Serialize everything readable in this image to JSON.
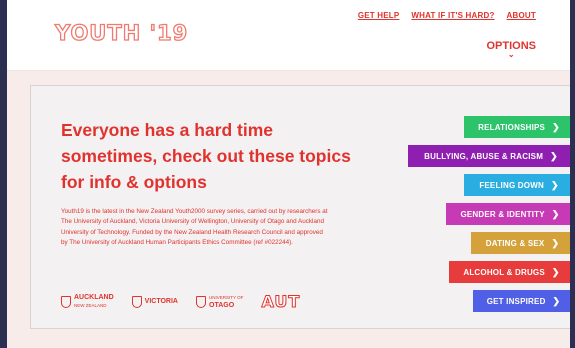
{
  "header": {
    "logo": "YOUTH '19",
    "links": [
      "GET HELP",
      "WHAT IF IT'S HARD?",
      "ABOUT"
    ],
    "options_label": "OPTIONS",
    "options_chevron": "⌄"
  },
  "main": {
    "headline": "Everyone has a hard time sometimes, check out these topics for info & options",
    "description": "Youth19 is the latest in the New Zealand Youth2000 survey series, carried out by researchers at The University of Auckland, Victoria University of Wellington, University of Otago and Auckland University of Technology. Funded by the New Zealand Health Research Council and approved by The University of Auckland Human Participants Ethics Committee (ref #022244).",
    "partners": [
      {
        "name": "AUCKLAND",
        "sub": "NEW ZEALAND",
        "icon": "auckland-crest-icon"
      },
      {
        "name": "VICTORIA",
        "sub": "",
        "icon": "victoria-crest-icon"
      },
      {
        "name": "OTAGO",
        "sub": "UNIVERSITY OF",
        "icon": "otago-crest-icon"
      },
      {
        "name": "AUT",
        "sub": "",
        "icon": ""
      }
    ],
    "topics": [
      {
        "label": "RELATIONSHIPS",
        "color": "#2cc36b"
      },
      {
        "label": "BULLYING, ABUSE & RACISM",
        "color": "#8e1fb0"
      },
      {
        "label": "FEELING DOWN",
        "color": "#2aaee1"
      },
      {
        "label": "GENDER & IDENTITY",
        "color": "#c63ab5"
      },
      {
        "label": "DATING & SEX",
        "color": "#d4a13a"
      },
      {
        "label": "ALCOHOL & DRUGS",
        "color": "#e83b3b"
      },
      {
        "label": "GET INSPIRED",
        "color": "#4f5fe6"
      }
    ],
    "arrow": "❯"
  }
}
